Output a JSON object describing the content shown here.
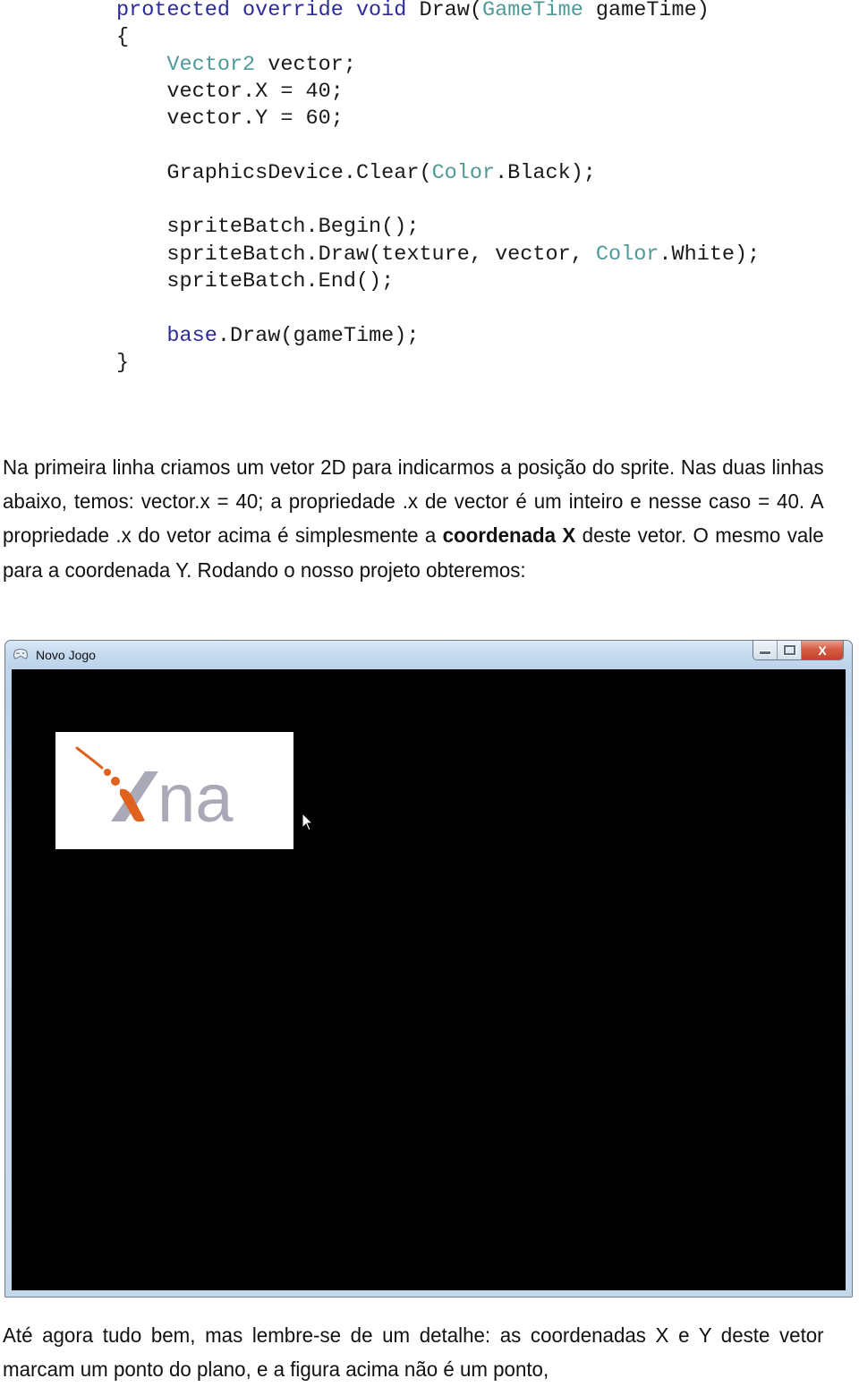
{
  "code": {
    "lines": [
      [
        {
          "t": "protected override void ",
          "c": "kw"
        },
        {
          "t": "Draw(",
          "c": ""
        },
        {
          "t": "GameTime",
          "c": "ty"
        },
        {
          "t": " gameTime)",
          "c": ""
        }
      ],
      [
        {
          "t": "{",
          "c": ""
        }
      ],
      [
        {
          "t": "    ",
          "c": ""
        },
        {
          "t": "Vector2",
          "c": "ty"
        },
        {
          "t": " vector;",
          "c": ""
        }
      ],
      [
        {
          "t": "    vector.X = 40;",
          "c": ""
        }
      ],
      [
        {
          "t": "    vector.Y = 60;",
          "c": ""
        }
      ],
      [
        {
          "t": "",
          "c": ""
        }
      ],
      [
        {
          "t": "    GraphicsDevice.Clear(",
          "c": ""
        },
        {
          "t": "Color",
          "c": "ty"
        },
        {
          "t": ".Black);",
          "c": ""
        }
      ],
      [
        {
          "t": "",
          "c": ""
        }
      ],
      [
        {
          "t": "    spriteBatch.Begin();",
          "c": ""
        }
      ],
      [
        {
          "t": "    spriteBatch.Draw(texture, vector, ",
          "c": ""
        },
        {
          "t": "Color",
          "c": "ty"
        },
        {
          "t": ".White);",
          "c": ""
        }
      ],
      [
        {
          "t": "    spriteBatch.End();",
          "c": ""
        }
      ],
      [
        {
          "t": "",
          "c": ""
        }
      ],
      [
        {
          "t": "    ",
          "c": ""
        },
        {
          "t": "base",
          "c": "kw"
        },
        {
          "t": ".Draw(gameTime);",
          "c": ""
        }
      ],
      [
        {
          "t": "}",
          "c": ""
        }
      ]
    ]
  },
  "paragraph1": {
    "before": "Na primeira linha criamos um vetor 2D para indicarmos a posição do sprite. Nas duas linhas abaixo, temos: vector.x = 40; a propriedade .x de vector é um inteiro e nesse caso = 40. A propriedade .x do vetor acima é simplesmente a ",
    "bold": "coordenada X",
    "after": " deste vetor. O mesmo vale para a coordenada Y. Rodando o nosso projeto obteremos:"
  },
  "window": {
    "title": "Novo Jogo",
    "close_glyph": "X",
    "sprite_text": "xna",
    "colors": {
      "logo_orange": "#e0621f",
      "logo_gray": "#a9a9b8",
      "client_bg": "#000000"
    }
  },
  "paragraph2": {
    "text": "Até agora tudo bem, mas lembre-se de um detalhe: as coordenadas X e Y deste vetor marcam um ponto do plano, e a figura acima não é um ponto,"
  }
}
